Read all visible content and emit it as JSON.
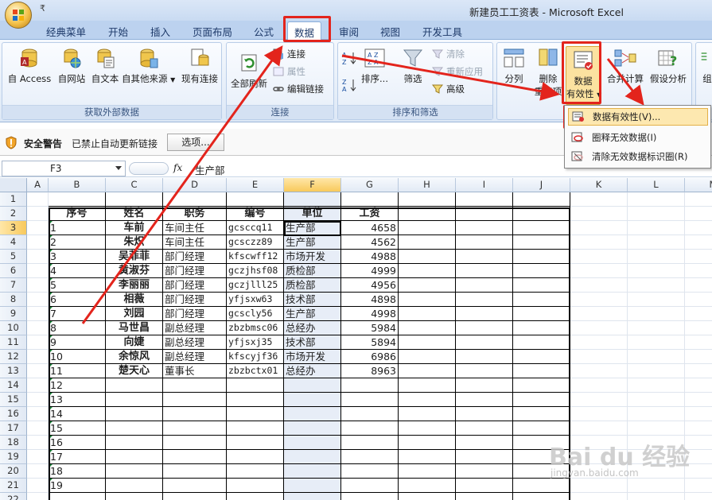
{
  "window": {
    "title": "新建员工工资表 - Microsoft Excel",
    "qat": "₹"
  },
  "tabs": [
    "经典菜单",
    "开始",
    "插入",
    "页面布局",
    "公式",
    "数据",
    "审阅",
    "视图",
    "开发工具"
  ],
  "ribbon": {
    "groups": {
      "external": "获取外部数据",
      "connections": "连接",
      "sortfilter": "排序和筛选"
    },
    "buttons": {
      "access": "自 Access",
      "web": "自网站",
      "text": "自文本",
      "other": "自其他来源",
      "existing": "现有连接",
      "refresh": "全部刷新",
      "connect": "连接",
      "props": "属性",
      "editlinks": "编辑链接",
      "sort": "排序...",
      "filter": "筛选",
      "clear": "清除",
      "reapply": "重新应用",
      "advanced": "高级",
      "split": "分列",
      "dedupe1": "删除",
      "dedupe2": "重复项",
      "validity1": "数据",
      "validity2": "有效性",
      "consolidate": "合并计算",
      "whatif": "假设分析",
      "group": "组"
    }
  },
  "menu": {
    "items": [
      "数据有效性(V)...",
      "圈释无效数据(I)",
      "清除无效数据标识圈(R)"
    ]
  },
  "security": {
    "title": "安全警告",
    "message": "已禁止自动更新链接",
    "options": "选项..."
  },
  "formula": {
    "namebox": "F3",
    "fx": "fx",
    "content": "生产部"
  },
  "sheet": {
    "columns": [
      "A",
      "B",
      "C",
      "D",
      "E",
      "F",
      "G",
      "H",
      "I",
      "J",
      "K",
      "L",
      "M"
    ],
    "rows": [
      "1",
      "2",
      "3",
      "4",
      "5",
      "6",
      "7",
      "8",
      "9",
      "10",
      "11",
      "12",
      "13",
      "14",
      "15",
      "16",
      "17",
      "18",
      "19",
      "20",
      "21",
      "22"
    ],
    "headers": [
      "序号",
      "姓名",
      "职务",
      "编号",
      "单位",
      "工资"
    ],
    "data": [
      [
        "1",
        "车前",
        "车间主任",
        "gcsccq11",
        "生产部",
        "4658"
      ],
      [
        "2",
        "朱炽",
        "车间主任",
        "gcsczz89",
        "生产部",
        "4562"
      ],
      [
        "3",
        "吴菲菲",
        "部门经理",
        "kfscwff12",
        "市场开发",
        "4988"
      ],
      [
        "4",
        "黄淑芬",
        "部门经理",
        "gczjhsf08",
        "质检部",
        "4999"
      ],
      [
        "5",
        "李丽丽",
        "部门经理",
        "gczjlll25",
        "质检部",
        "4956"
      ],
      [
        "6",
        "相薇",
        "部门经理",
        "yfjsxw63",
        "技术部",
        "4898"
      ],
      [
        "7",
        "刘园",
        "部门经理",
        "gcscly56",
        "生产部",
        "4998"
      ],
      [
        "8",
        "马世昌",
        "副总经理",
        "zbzbmsc06",
        "总经办",
        "5984"
      ],
      [
        "9",
        "向婕",
        "副总经理",
        "yfjsxj35",
        "技术部",
        "5894"
      ],
      [
        "10",
        "余惊风",
        "副总经理",
        "kfscyjf36",
        "市场开发",
        "6986"
      ],
      [
        "11",
        "楚天心",
        "董事长",
        "zbzbctx01",
        "总经办",
        "8963"
      ]
    ],
    "extra_ids": [
      "12",
      "13",
      "14",
      "15",
      "16",
      "17",
      "18",
      "19"
    ]
  },
  "watermark": {
    "brand": "Bai du 经验",
    "url": "jingyan.baidu.com"
  },
  "colors": {
    "annotation_red": "#e3241c",
    "selection": "#f8c95c",
    "ribbon_blue": "#bcd2ef"
  }
}
